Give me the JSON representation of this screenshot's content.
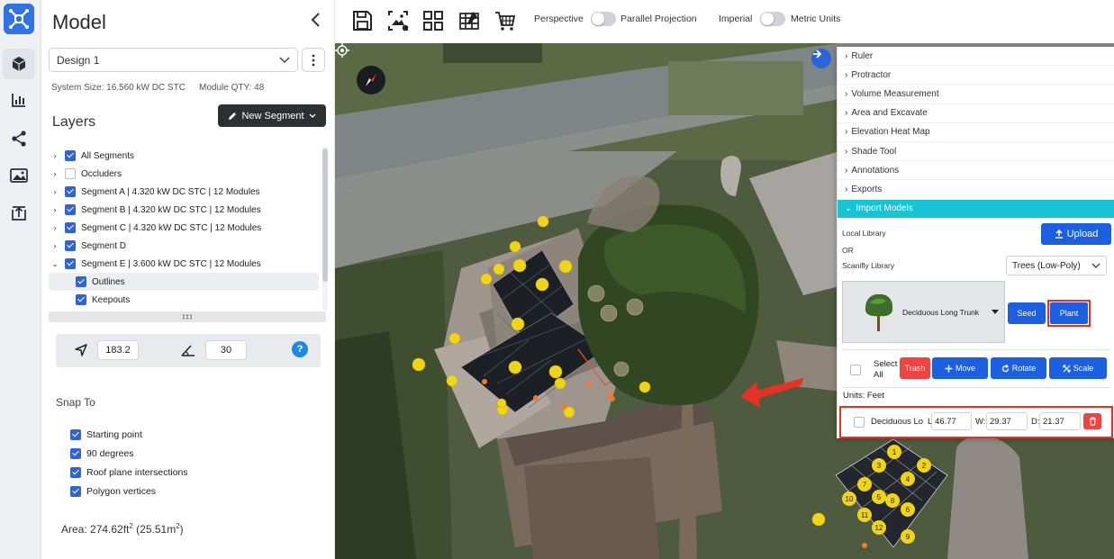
{
  "panel": {
    "title": "Model",
    "design_selected": "Design 1",
    "system_size": "System Size: 16.560 kW DC STC",
    "module_qty": "Module QTY: 48",
    "layers_title": "Layers",
    "new_segment_label": "New Segment",
    "layers": [
      {
        "label": "All Segments",
        "checked": true
      },
      {
        "label": "Occluders",
        "checked": false
      },
      {
        "label": "Segment A | 4.320 kW DC STC | 12 Modules",
        "checked": true
      },
      {
        "label": "Segment B | 4.320 kW DC STC | 12 Modules",
        "checked": true
      },
      {
        "label": "Segment C | 4.320 kW DC STC | 12 Modules",
        "checked": true
      },
      {
        "label": "Segment D",
        "checked": true
      },
      {
        "label": "Segment E | 3.600 kW DC STC | 12 Modules",
        "checked": true,
        "expanded": true
      },
      {
        "label": "Outlines",
        "checked": true
      },
      {
        "label": "Keepouts",
        "checked": true
      }
    ],
    "azimuth": "183.2",
    "pitch": "30",
    "help_label": "?",
    "snap_title": "Snap To",
    "snap_options": [
      {
        "label": "Starting point",
        "checked": true
      },
      {
        "label": "90 degrees",
        "checked": true
      },
      {
        "label": "Roof plane intersections",
        "checked": true
      },
      {
        "label": "Polygon vertices",
        "checked": true
      }
    ],
    "area_prefix": "Area: 274.62ft",
    "area_mid": "  (25.51m",
    "area_sup": "2",
    "area_suffix": ")"
  },
  "toolbar": {
    "perspective_label": "Perspective",
    "parallel_label": "Parallel Projection",
    "imperial_label": "Imperial",
    "metric_label": "Metric Units"
  },
  "tools": {
    "items": [
      "Ruler",
      "Protractor",
      "Volume Measurement",
      "Area and Excavate",
      "Elevation Heat Map",
      "Shade Tool",
      "Annotations",
      "Exports",
      "Import Models"
    ],
    "local_library": "Local Library",
    "or": "OR",
    "scanifly_library": "Scanifly Library",
    "upload_label": "Upload",
    "tree_type": "Trees (Low-Poly)",
    "model_name": "Deciduous Long Trunk",
    "seed_label": "Seed",
    "plant_label": "Plant",
    "select_all": "Select All",
    "trash_label": "Trash",
    "move_label": "Move",
    "rotate_label": "Rotate",
    "scale_label": "Scale",
    "units": "Units: Feet",
    "object": {
      "name": "Deciduous Lo",
      "l_label": "L:",
      "l_value": "46.77",
      "w_label": "W:",
      "w_value": "29.37",
      "d_label": "D:",
      "d_value": "21.37"
    }
  },
  "scene": {
    "module_labels": [
      "1",
      "2",
      "3",
      "4",
      "5",
      "6",
      "7",
      "8",
      "9",
      "10",
      "11",
      "12"
    ]
  },
  "colors": {
    "primary": "#1c5fe0",
    "active_tool": "#18c4d4",
    "danger": "#ef4444",
    "highlight": "#e53226"
  }
}
